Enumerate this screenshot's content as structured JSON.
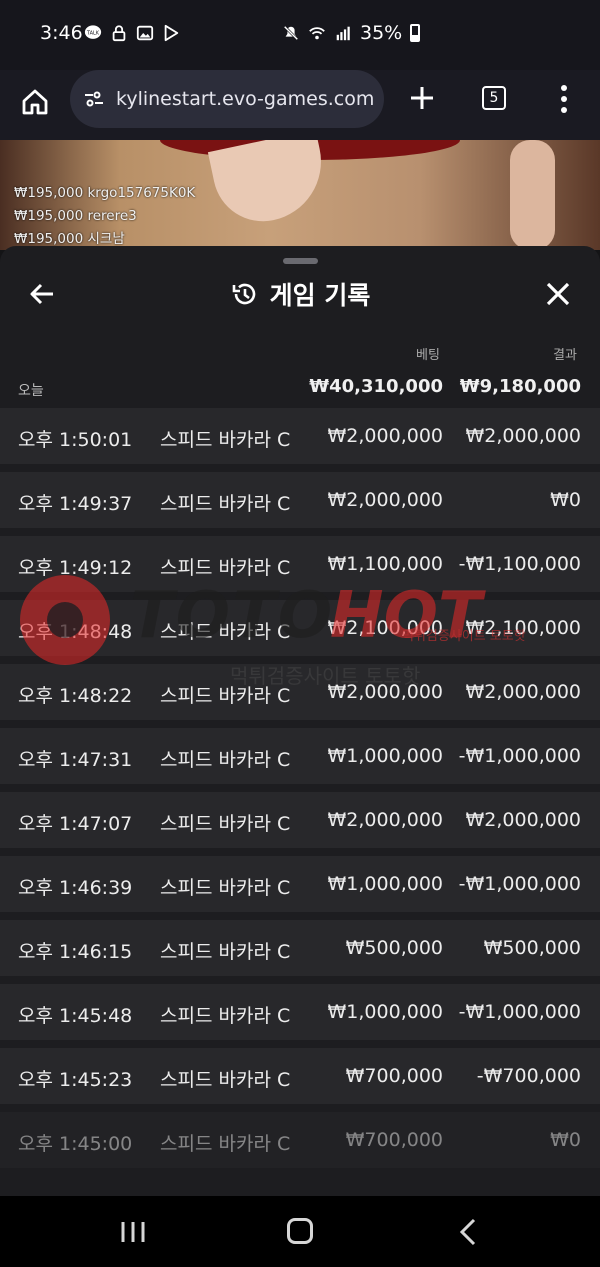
{
  "status_bar": {
    "time": "3:46",
    "talk_label": "TALK",
    "battery": "35%"
  },
  "browser": {
    "url": "kylinestart.evo-games.com",
    "tab_count": "5"
  },
  "video_overlay": {
    "bets": [
      {
        "amount": "₩195,000",
        "user": "krgo157675K0K"
      },
      {
        "amount": "₩195,000",
        "user": "rerere3"
      },
      {
        "amount": "₩195,000",
        "user": "시크남"
      }
    ]
  },
  "sheet": {
    "title": "게임 기록",
    "col_bet": "베팅",
    "col_result": "결과",
    "today_label": "오늘",
    "total_bet": "₩40,310,000",
    "total_result": "₩9,180,000",
    "rows": [
      {
        "time": "오후 1:50:01",
        "game": "스피드 바카라 C",
        "bet": "₩2,000,000",
        "result": "₩2,000,000"
      },
      {
        "time": "오후 1:49:37",
        "game": "스피드 바카라 C",
        "bet": "₩2,000,000",
        "result": "₩0"
      },
      {
        "time": "오후 1:49:12",
        "game": "스피드 바카라 C",
        "bet": "₩1,100,000",
        "result": "-₩1,100,000"
      },
      {
        "time": "오후 1:48:48",
        "game": "스피드 바카라 C",
        "bet": "₩2,100,000",
        "result": "₩2,100,000"
      },
      {
        "time": "오후 1:48:22",
        "game": "스피드 바카라 C",
        "bet": "₩2,000,000",
        "result": "₩2,000,000"
      },
      {
        "time": "오후 1:47:31",
        "game": "스피드 바카라 C",
        "bet": "₩1,000,000",
        "result": "-₩1,000,000"
      },
      {
        "time": "오후 1:47:07",
        "game": "스피드 바카라 C",
        "bet": "₩2,000,000",
        "result": "₩2,000,000"
      },
      {
        "time": "오후 1:46:39",
        "game": "스피드 바카라 C",
        "bet": "₩1,000,000",
        "result": "-₩1,000,000"
      },
      {
        "time": "오후 1:46:15",
        "game": "스피드 바카라 C",
        "bet": "₩500,000",
        "result": "₩500,000"
      },
      {
        "time": "오후 1:45:48",
        "game": "스피드 바카라 C",
        "bet": "₩1,000,000",
        "result": "-₩1,000,000"
      },
      {
        "time": "오후 1:45:23",
        "game": "스피드 바카라 C",
        "bet": "₩700,000",
        "result": "-₩700,000"
      },
      {
        "time": "오후 1:45:00",
        "game": "스피드 바카라 C",
        "bet": "₩700,000",
        "result": "₩0"
      }
    ]
  },
  "watermark": {
    "brand_a": "TOTO",
    "brand_b": "HOT",
    "sub": "먹튀검증사이트 토토핫",
    "sub_small": "먹튀검증사이트 토토핫"
  }
}
